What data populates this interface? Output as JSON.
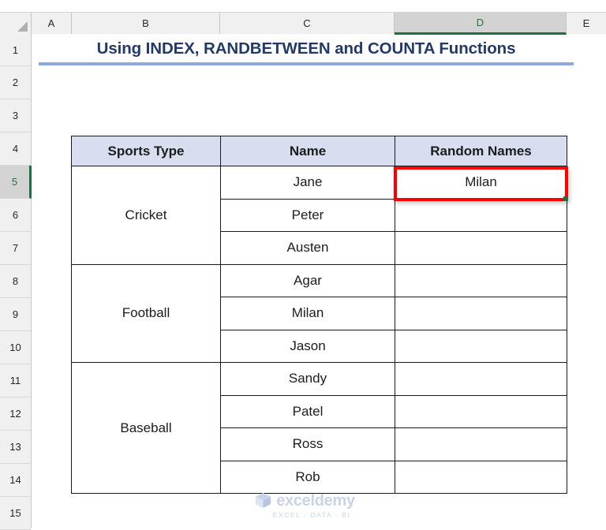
{
  "app": {
    "type": "spreadsheet",
    "selected_column": "D",
    "selected_row": "5"
  },
  "grid": {
    "column_headers": [
      "A",
      "B",
      "C",
      "D",
      "E"
    ],
    "row_headers": [
      "1",
      "2",
      "3",
      "4",
      "5",
      "6",
      "7",
      "8",
      "9",
      "10",
      "11",
      "12",
      "13",
      "14",
      "15"
    ],
    "corner_icon": "select-all-triangle-icon"
  },
  "title": {
    "text": "Using INDEX, RANDBETWEEN and COUNTA Functions",
    "color": "#223a6b",
    "rule_color": "#8ea9db"
  },
  "table": {
    "header_fill": "#d9ddf0",
    "border_color": "#1a1a1a",
    "headers": [
      "Sports Type",
      "Name",
      "Random Names"
    ],
    "groups": [
      {
        "sport": "Cricket",
        "names": [
          "Jane",
          "Peter",
          "Austen"
        ]
      },
      {
        "sport": "Football",
        "names": [
          "Agar",
          "Milan",
          "Jason"
        ]
      },
      {
        "sport": "Baseball",
        "names": [
          "Sandy",
          "Patel",
          "Ross",
          "Rob"
        ]
      }
    ],
    "random_names": [
      "Milan",
      "",
      "",
      "",
      "",
      "",
      "",
      "",
      "",
      ""
    ]
  },
  "selection": {
    "cell": "D5",
    "value": "Milan",
    "outline_color": "#ff0000",
    "handle_color": "#1d7044"
  },
  "watermark": {
    "brand": "exceldemy",
    "tagline": "EXCEL - DATA - BI",
    "color": "#c9d3ea"
  }
}
